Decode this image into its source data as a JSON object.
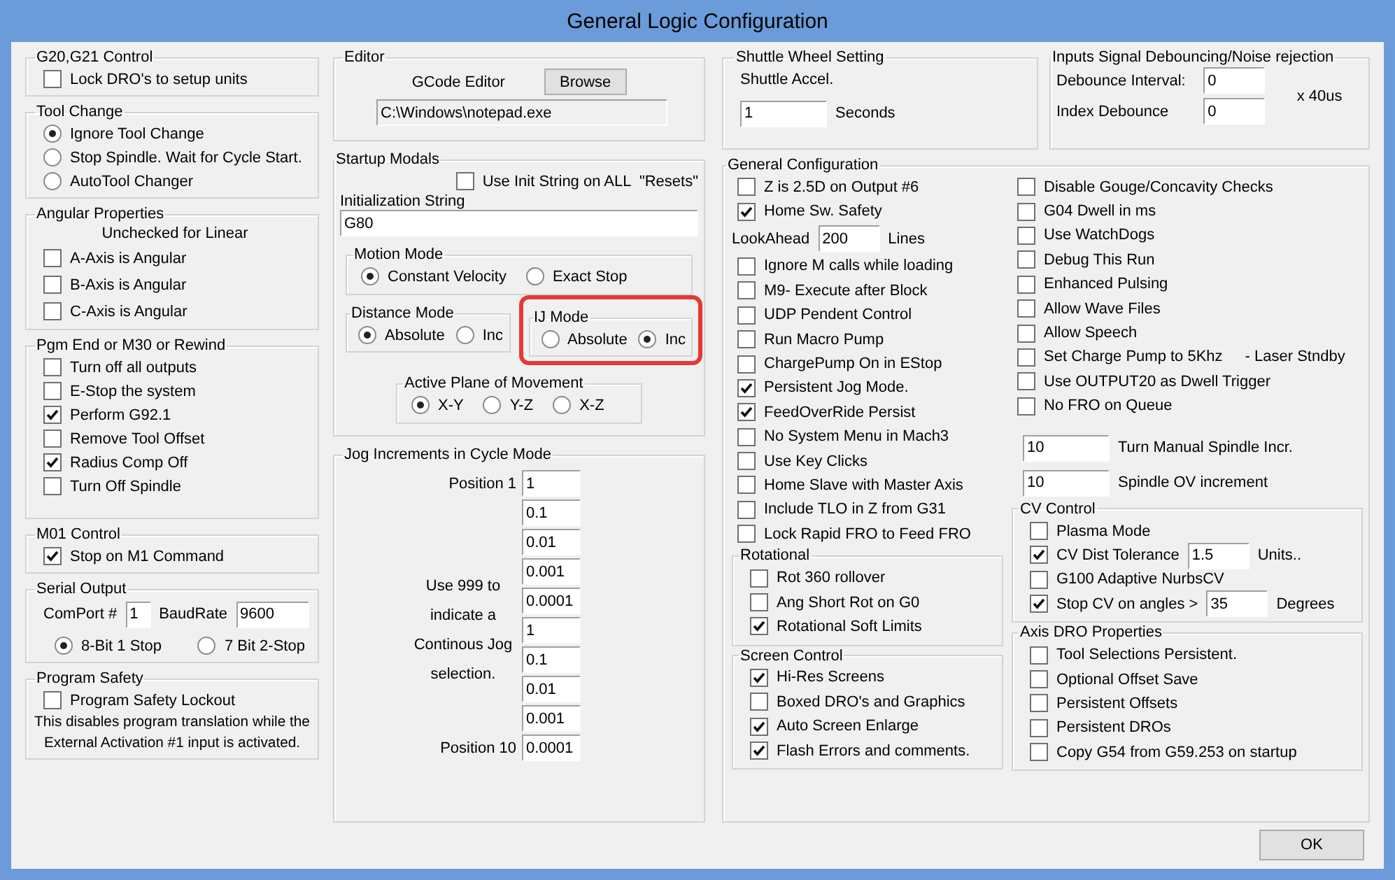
{
  "window": {
    "title": "General Logic Configuration"
  },
  "left_column": [
    {
      "title": "G20,G21 Control",
      "items": [
        {
          "kind": "checkbox",
          "label": "Lock DRO's to setup units",
          "checked": false
        }
      ]
    },
    {
      "title": "Tool Change",
      "items": [
        {
          "kind": "radio",
          "label": "Ignore Tool Change",
          "selected": true
        },
        {
          "kind": "radio",
          "label": "Stop Spindle. Wait for Cycle Start.",
          "selected": false
        },
        {
          "kind": "radio",
          "label": "AutoTool Changer",
          "selected": false
        }
      ]
    },
    {
      "title": "Angular Properties",
      "items": [
        {
          "kind": "note",
          "text": "Unchecked for Linear"
        },
        {
          "kind": "checkbox",
          "label": "A-Axis is Angular",
          "checked": false
        },
        {
          "kind": "checkbox",
          "label": "B-Axis is Angular",
          "checked": false
        },
        {
          "kind": "checkbox",
          "label": "C-Axis is Angular",
          "checked": false
        }
      ]
    },
    {
      "title": "Pgm End or M30 or Rewind",
      "items": [
        {
          "kind": "checkbox",
          "label": "Turn off all outputs",
          "checked": false
        },
        {
          "kind": "checkbox",
          "label": "E-Stop the system",
          "checked": false
        },
        {
          "kind": "checkbox",
          "label": "Perform G92.1",
          "checked": true
        },
        {
          "kind": "checkbox",
          "label": "Remove Tool Offset",
          "checked": false
        },
        {
          "kind": "checkbox",
          "label": "Radius Comp Off",
          "checked": true
        },
        {
          "kind": "checkbox",
          "label": "Turn Off Spindle",
          "checked": false
        }
      ]
    },
    {
      "title": "M01 Control",
      "items": [
        {
          "kind": "checkbox",
          "label": "Stop on M1 Command",
          "checked": true
        }
      ]
    },
    {
      "title": "Serial Output",
      "items": [
        {
          "kind": "fields",
          "fields": [
            {
              "label": "ComPort #",
              "value": "1"
            },
            {
              "label": "BaudRate",
              "value": "9600"
            }
          ]
        },
        {
          "kind": "radio_row",
          "options": [
            {
              "label": "8-Bit 1 Stop",
              "selected": true
            },
            {
              "label": "7 Bit 2-Stop",
              "selected": false
            }
          ]
        }
      ]
    },
    {
      "title": "Program Safety",
      "items": [
        {
          "kind": "checkbox",
          "label": "Program Safety Lockout",
          "checked": false
        },
        {
          "kind": "note",
          "text": "This disables program translation while the External Activation #1 input is activated."
        }
      ]
    }
  ],
  "middle_column": [
    {
      "title": "Editor",
      "items": [
        {
          "kind": "button_row",
          "label": "GCode Editor",
          "button": "Browse"
        },
        {
          "kind": "path",
          "value": "C:\\Windows\\notepad.exe"
        }
      ]
    },
    {
      "title": "Startup Modals",
      "items": [
        {
          "kind": "checkbox",
          "label": "Use Init String on ALL  \"Resets\"",
          "checked": false
        },
        {
          "kind": "stacked_field",
          "label": "Initialization String",
          "value": "G80"
        },
        {
          "kind": "group",
          "title": "Motion Mode",
          "items": [
            {
              "kind": "radio_row",
              "options": [
                {
                  "label": "Constant Velocity",
                  "selected": true
                },
                {
                  "label": "Exact Stop",
                  "selected": false
                }
              ]
            }
          ]
        },
        {
          "kind": "group_row",
          "groups": [
            {
              "kind": "group",
              "title": "Distance Mode",
              "highlighted": false,
              "items": [
                {
                  "kind": "radio_row",
                  "options": [
                    {
                      "label": "Absolute",
                      "selected": true
                    },
                    {
                      "label": "Inc",
                      "selected": false
                    }
                  ]
                }
              ]
            },
            {
              "kind": "group",
              "title": "IJ Mode",
              "highlighted": true,
              "items": [
                {
                  "kind": "radio_row",
                  "options": [
                    {
                      "label": "Absolute",
                      "selected": false
                    },
                    {
                      "label": "Inc",
                      "selected": true
                    }
                  ]
                }
              ]
            }
          ]
        },
        {
          "kind": "group",
          "title": "Active Plane of Movement",
          "items": [
            {
              "kind": "radio_row",
              "options": [
                {
                  "label": "X-Y",
                  "selected": true
                },
                {
                  "label": "Y-Z",
                  "selected": false
                },
                {
                  "label": "X-Z",
                  "selected": false
                }
              ]
            }
          ]
        }
      ]
    },
    {
      "title": "Jog Increments in Cycle Mode",
      "items": [
        {
          "kind": "jog_list",
          "first_label": "Position 1",
          "note": "Use 999 to indicate a Continous Jog selection.",
          "last_label": "Position 10",
          "values": [
            "1",
            "0.1",
            "0.01",
            "0.001",
            "0.0001",
            "1",
            "0.1",
            "0.01",
            "0.001",
            "0.0001"
          ]
        }
      ]
    }
  ],
  "right_column": {
    "top": [
      {
        "title": "Shuttle Wheel Setting",
        "items": [
          {
            "kind": "note",
            "text": "Shuttle Accel."
          },
          {
            "kind": "field",
            "value": "1",
            "unit": "Seconds"
          }
        ]
      },
      {
        "title": "Inputs Signal Debouncing/Noise rejection",
        "items": [
          {
            "kind": "debounce",
            "fields": [
              {
                "label": "Debounce Interval:",
                "value": "0"
              },
              {
                "label": "Index Debounce",
                "value": "0"
              }
            ],
            "unit": "x 40us"
          }
        ]
      }
    ],
    "general": {
      "title": "General Configuration",
      "columns": [
        [
          {
            "kind": "checkbox",
            "label": "Z is 2.5D on Output #6",
            "checked": false
          },
          {
            "kind": "checkbox",
            "label": "Home Sw. Safety",
            "checked": true
          },
          {
            "kind": "field",
            "label": "LookAhead",
            "value": "200",
            "unit": "Lines"
          },
          {
            "kind": "checkbox",
            "label": "Ignore M calls while loading",
            "checked": false
          },
          {
            "kind": "checkbox",
            "label": "M9- Execute after Block",
            "checked": false
          },
          {
            "kind": "checkbox",
            "label": "UDP Pendent Control",
            "checked": false
          },
          {
            "kind": "checkbox",
            "label": "Run Macro Pump",
            "checked": false
          },
          {
            "kind": "checkbox",
            "label": "ChargePump On in EStop",
            "checked": false
          },
          {
            "kind": "checkbox",
            "label": "Persistent Jog Mode.",
            "checked": true
          },
          {
            "kind": "checkbox",
            "label": "FeedOverRide Persist",
            "checked": true
          },
          {
            "kind": "checkbox",
            "label": "No System Menu in Mach3",
            "checked": false
          },
          {
            "kind": "checkbox",
            "label": "Use Key Clicks",
            "checked": false
          },
          {
            "kind": "checkbox",
            "label": "Home Slave with Master Axis",
            "checked": false
          },
          {
            "kind": "checkbox",
            "label": "Include TLO in Z from G31",
            "checked": false
          },
          {
            "kind": "checkbox",
            "label": "Lock Rapid FRO to Feed FRO",
            "checked": false
          },
          {
            "kind": "group",
            "title": "Rotational",
            "items": [
              {
                "kind": "checkbox",
                "label": "Rot 360 rollover",
                "checked": false
              },
              {
                "kind": "checkbox",
                "label": "Ang Short Rot on G0",
                "checked": false
              },
              {
                "kind": "checkbox",
                "label": "Rotational Soft Limits",
                "checked": true
              }
            ]
          },
          {
            "kind": "group",
            "title": "Screen Control",
            "items": [
              {
                "kind": "checkbox",
                "label": "Hi-Res Screens",
                "checked": true
              },
              {
                "kind": "checkbox",
                "label": "Boxed DRO's and Graphics",
                "checked": false
              },
              {
                "kind": "checkbox",
                "label": "Auto Screen Enlarge",
                "checked": true
              },
              {
                "kind": "checkbox",
                "label": "Flash Errors and comments.",
                "checked": true
              }
            ]
          }
        ],
        [
          {
            "kind": "checkbox",
            "label": "Disable Gouge/Concavity Checks",
            "checked": false
          },
          {
            "kind": "checkbox",
            "label": "G04 Dwell in ms",
            "checked": false
          },
          {
            "kind": "checkbox",
            "label": "Use WatchDogs",
            "checked": false
          },
          {
            "kind": "checkbox",
            "label": "Debug This Run",
            "checked": false
          },
          {
            "kind": "checkbox",
            "label": "Enhanced Pulsing",
            "checked": false
          },
          {
            "kind": "checkbox",
            "label": "Allow Wave Files",
            "checked": false
          },
          {
            "kind": "checkbox",
            "label": "Allow Speech",
            "checked": false
          },
          {
            "kind": "checkbox",
            "label": "Set Charge Pump to 5Khz",
            "note": "- Laser Stndby",
            "checked": false
          },
          {
            "kind": "checkbox",
            "label": "Use OUTPUT20 as Dwell Trigger",
            "checked": false
          },
          {
            "kind": "checkbox",
            "label": "No FRO on Queue",
            "checked": false
          },
          {
            "kind": "value_field",
            "value": "10",
            "caption": "Turn Manual Spindle Incr."
          },
          {
            "kind": "value_field",
            "value": "10",
            "caption": "Spindle OV increment"
          },
          {
            "kind": "group",
            "title": "CV Control",
            "items": [
              {
                "kind": "checkbox",
                "label": "Plasma Mode",
                "checked": false
              },
              {
                "kind": "checkbox",
                "label": "CV Dist Tolerance",
                "checked": true,
                "value": "1.5",
                "unit": "Units.."
              },
              {
                "kind": "checkbox",
                "label": "G100 Adaptive NurbsCV",
                "checked": false
              },
              {
                "kind": "checkbox",
                "label": "Stop CV on angles >",
                "checked": true,
                "value": "35",
                "unit": "Degrees"
              }
            ]
          },
          {
            "kind": "group",
            "title": "Axis DRO Properties",
            "items": [
              {
                "kind": "checkbox",
                "label": "Tool Selections Persistent.",
                "checked": false
              },
              {
                "kind": "checkbox",
                "label": "Optional Offset Save",
                "checked": false
              },
              {
                "kind": "checkbox",
                "label": "Persistent Offsets",
                "checked": false
              },
              {
                "kind": "checkbox",
                "label": "Persistent DROs",
                "checked": false
              },
              {
                "kind": "checkbox",
                "label": "Copy G54 from G59.253 on startup",
                "checked": false
              }
            ]
          }
        ]
      ]
    }
  },
  "ok_button": "OK"
}
